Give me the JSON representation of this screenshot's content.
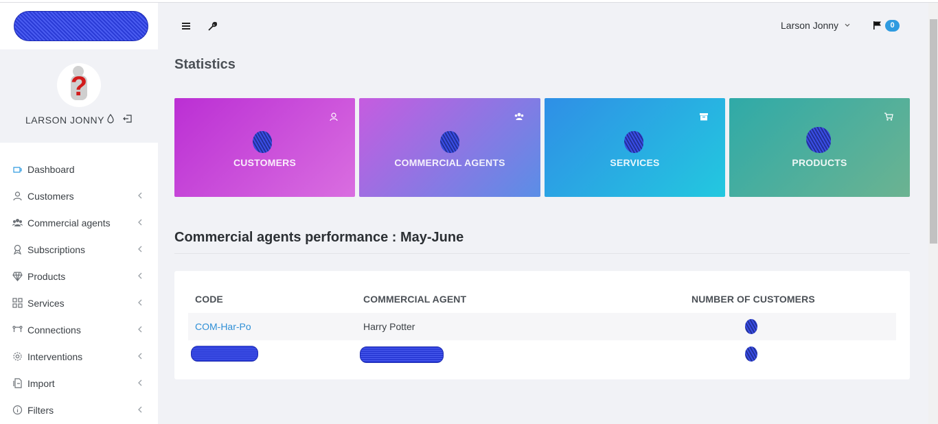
{
  "colors": {
    "accent": "#2f9be0",
    "link": "#2f8fd6",
    "sidebar_bg": "#ffffff",
    "page_bg": "#f1f2f6"
  },
  "sidebar": {
    "logo_icon": "logo-image",
    "profile": {
      "name": "LARSON JONNY",
      "avatar_icon": "user-avatar-icon"
    },
    "items": [
      {
        "label": "Dashboard",
        "icon": "dashboard-icon",
        "active": true
      },
      {
        "label": "Customers",
        "icon": "customers-icon"
      },
      {
        "label": "Commercial agents",
        "icon": "users-icon"
      },
      {
        "label": "Subscriptions",
        "icon": "award-icon"
      },
      {
        "label": "Products",
        "icon": "diamond-icon"
      },
      {
        "label": "Services",
        "icon": "grid-icon"
      },
      {
        "label": "Connections",
        "icon": "connections-icon"
      },
      {
        "label": "Interventions",
        "icon": "gear-icon"
      },
      {
        "label": "Import",
        "icon": "import-icon"
      },
      {
        "label": "Filters",
        "icon": "info-icon"
      }
    ]
  },
  "header": {
    "user_name": "Larson Jonny",
    "notification_count": "0"
  },
  "main": {
    "title": "Statistics",
    "cards": [
      {
        "label": "CUSTOMERS",
        "icon": "customer-icon"
      },
      {
        "label": "COMMERCIAL AGENTS",
        "icon": "users-icon"
      },
      {
        "label": "SERVICES",
        "icon": "archive-icon"
      },
      {
        "label": "PRODUCTS",
        "icon": "cart-icon"
      }
    ],
    "performance": {
      "title": "Commercial agents performance : May-June",
      "columns": [
        "CODE",
        "COMMERCIAL AGENT",
        "NUMBER OF CUSTOMERS"
      ],
      "rows": [
        {
          "code": "COM-Har-Po",
          "agent": "Harry Potter"
        },
        {
          "code": "",
          "agent": ""
        }
      ]
    }
  }
}
